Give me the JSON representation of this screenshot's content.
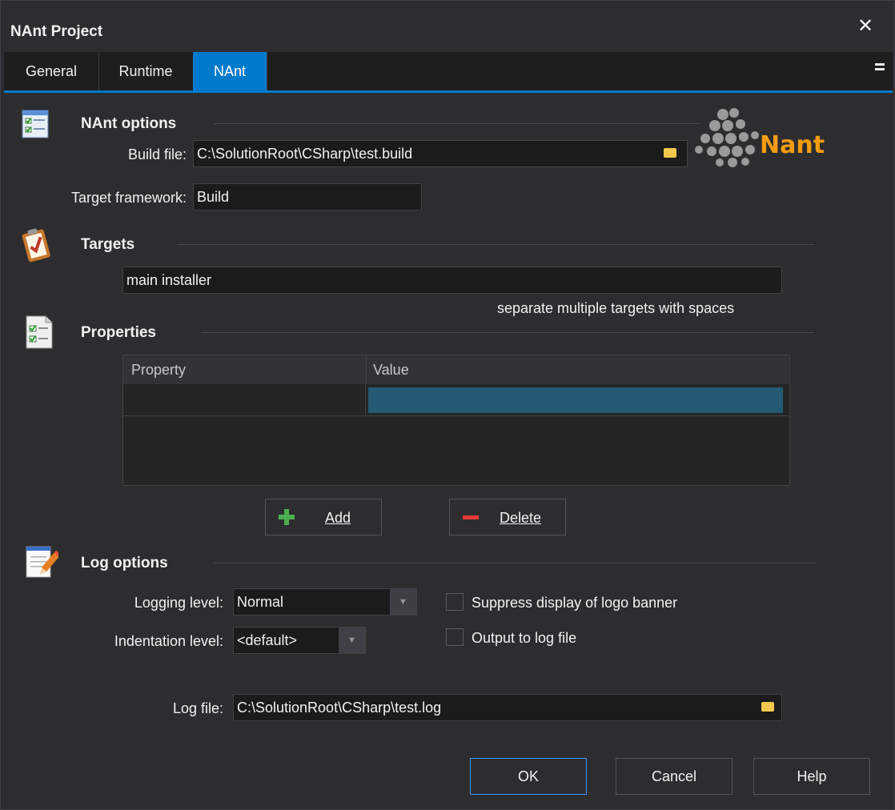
{
  "window": {
    "title": "NAnt Project"
  },
  "tabs": [
    {
      "label": "General",
      "active": false
    },
    {
      "label": "Runtime",
      "active": false
    },
    {
      "label": "NAnt",
      "active": true
    }
  ],
  "nant_options": {
    "title": "NAnt options",
    "build_file_label": "Build file:",
    "build_file_value": "C:\\SolutionRoot\\CSharp\\test.build",
    "target_framework_label": "Target framework:",
    "target_framework_value": "Build",
    "logo_text": "Nant"
  },
  "targets": {
    "title": "Targets",
    "value": "main installer",
    "hint": "separate multiple targets with spaces"
  },
  "properties": {
    "title": "Properties",
    "columns": [
      "Property",
      "Value"
    ],
    "rows": [
      {
        "property": "",
        "value": ""
      }
    ],
    "add_label": "Add",
    "delete_label": "Delete"
  },
  "log_options": {
    "title": "Log options",
    "logging_level_label": "Logging level:",
    "logging_level_value": "Normal",
    "indentation_level_label": "Indentation level:",
    "indentation_level_value": "<default>",
    "suppress_logo_label": "Suppress display of logo banner",
    "suppress_logo_checked": false,
    "output_to_log_label": "Output to log file",
    "output_to_log_checked": false,
    "log_file_label": "Log file:",
    "log_file_value": "C:\\SolutionRoot\\CSharp\\test.log"
  },
  "footer": {
    "ok_label": "OK",
    "cancel_label": "Cancel",
    "help_label": "Help"
  },
  "colors": {
    "accent": "#007acc",
    "background": "#2d2d30",
    "selected_cell": "#245a73",
    "logo_green": "#7ac142",
    "logo_orange": "#f39c12"
  }
}
